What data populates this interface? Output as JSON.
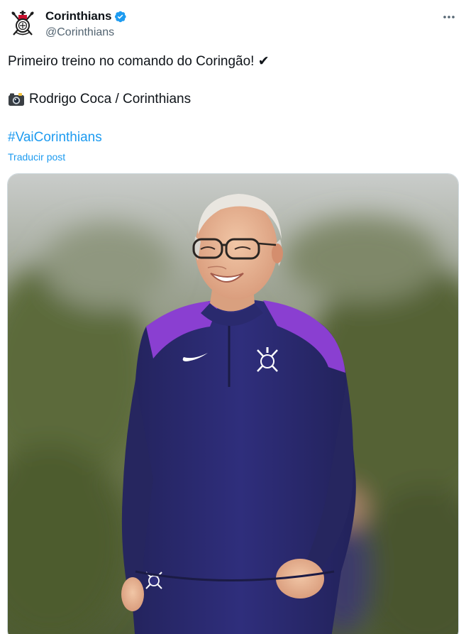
{
  "author": {
    "display_name": "Corinthians",
    "handle": "@Corinthians",
    "verified": true,
    "avatar_icon": "corinthians-crest-icon"
  },
  "post": {
    "line1": "Primeiro treino no comando do Coringão! ✔",
    "credit": "Rodrigo Coca / Corinthians",
    "hashtag": "#VaiCorinthians",
    "translate_label": "Traducir post"
  },
  "icons": {
    "more": "more-options-icon",
    "verified": "verified-badge-icon",
    "camera": "camera-icon"
  },
  "colors": {
    "link": "#1d9bf0",
    "verified_badge": "#1d9bf0",
    "secondary_text": "#536471",
    "jersey": "#2b2a75",
    "jersey_accent": "#8a3fd1"
  }
}
